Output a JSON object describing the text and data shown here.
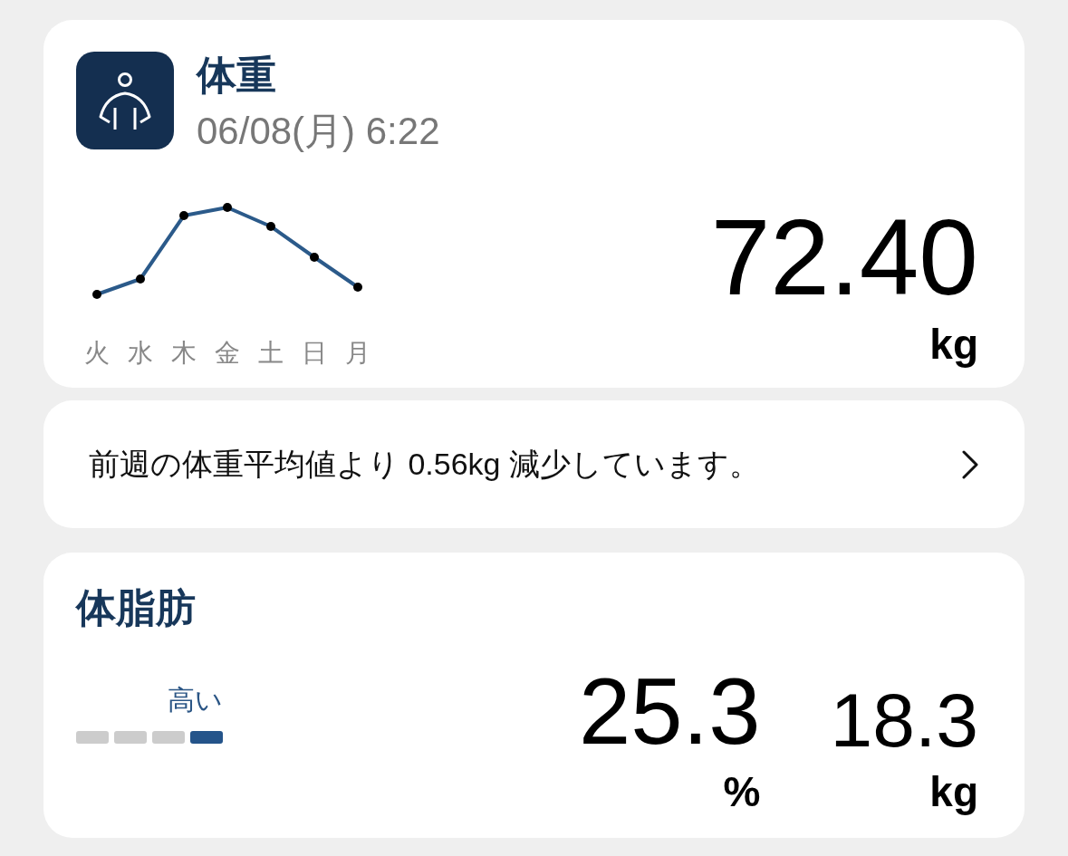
{
  "weight_card": {
    "title": "体重",
    "timestamp": "06/08(月) 6:22",
    "days": [
      "火",
      "水",
      "木",
      "金",
      "土",
      "日",
      "月"
    ],
    "value": "72.40",
    "unit": "kg"
  },
  "comparison": {
    "message": "前週の体重平均値より 0.56kg 減少しています。"
  },
  "body_fat_card": {
    "title": "体脂肪",
    "rating": {
      "label": "高い",
      "segments": [
        {
          "selected": false
        },
        {
          "selected": false
        },
        {
          "selected": false
        },
        {
          "selected": true
        }
      ]
    },
    "readings": [
      {
        "kind": "primary",
        "value": "25.3",
        "unit": "%"
      },
      {
        "kind": "secondary",
        "value": "18.3",
        "unit": "kg"
      }
    ]
  }
}
